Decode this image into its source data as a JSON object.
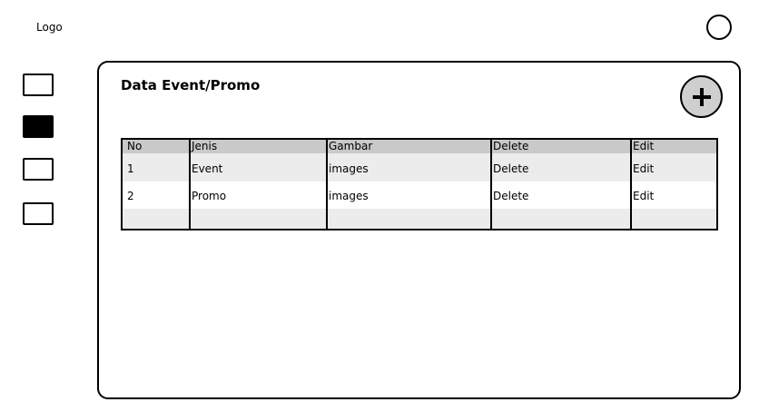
{
  "header": {
    "logo": "Logo"
  },
  "sidebar": {
    "items": [
      {
        "name": "nav-item-1",
        "active": false
      },
      {
        "name": "nav-item-2",
        "active": true
      },
      {
        "name": "nav-item-3",
        "active": false
      },
      {
        "name": "nav-item-4",
        "active": false
      }
    ]
  },
  "main": {
    "title": "Data Event/Promo",
    "add_button_icon": "plus-icon",
    "table": {
      "columns": [
        "No",
        "Jenis",
        "Gambar",
        "Delete",
        "Edit"
      ],
      "rows": [
        [
          "1",
          "Event",
          "images",
          "Delete",
          "Edit"
        ],
        [
          "2",
          "Promo",
          "images",
          "Delete",
          "Edit"
        ],
        [
          "",
          "",
          "",
          "",
          ""
        ]
      ]
    }
  }
}
